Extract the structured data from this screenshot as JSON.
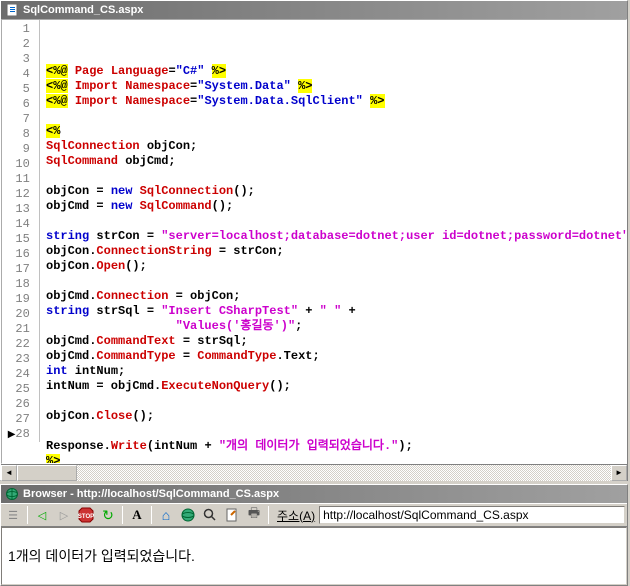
{
  "editor": {
    "title": "SqlCommand_CS.aspx",
    "lines": [
      {
        "n": "1",
        "html": "<span class='bg-yellow'>&lt;%@</span> <span class='kw-red'>Page</span> <span class='kw-red'>Language</span>=<span class='kw-blue'>\"C#\"</span> <span class='bg-yellow'>%&gt;</span>"
      },
      {
        "n": "2",
        "html": "<span class='bg-yellow'>&lt;%@</span> <span class='kw-red'>Import</span> <span class='kw-red'>Namespace</span>=<span class='kw-blue'>\"System.Data\"</span> <span class='bg-yellow'>%&gt;</span>"
      },
      {
        "n": "3",
        "html": "<span class='bg-yellow'>&lt;%@</span> <span class='kw-red'>Import</span> <span class='kw-red'>Namespace</span>=<span class='kw-blue'>\"System.Data.SqlClient\"</span> <span class='bg-yellow'>%&gt;</span>"
      },
      {
        "n": "4",
        "html": ""
      },
      {
        "n": "5",
        "html": "<span class='bg-yellow'>&lt;%</span>"
      },
      {
        "n": "6",
        "html": "<span class='kw-red'>SqlConnection</span> objCon;"
      },
      {
        "n": "7",
        "html": "<span class='kw-red'>SqlCommand</span> objCmd;"
      },
      {
        "n": "8",
        "html": ""
      },
      {
        "n": "9",
        "html": "objCon = <span class='kw-blue'>new</span> <span class='kw-red'>SqlConnection</span>();"
      },
      {
        "n": "10",
        "html": "objCmd = <span class='kw-blue'>new</span> <span class='kw-red'>SqlCommand</span>();"
      },
      {
        "n": "11",
        "html": ""
      },
      {
        "n": "12",
        "html": "<span class='kw-blue'>string</span> strCon = <span class='str'>\"server=localhost;database=dotnet;user id=dotnet;password=dotnet\"</span>;"
      },
      {
        "n": "13",
        "html": "objCon.<span class='kw-red'>ConnectionString</span> = strCon;"
      },
      {
        "n": "14",
        "html": "objCon.<span class='kw-red'>Open</span>();"
      },
      {
        "n": "15",
        "html": ""
      },
      {
        "n": "16",
        "html": "objCmd.<span class='kw-red'>Connection</span> = objCon;"
      },
      {
        "n": "17",
        "html": "<span class='kw-blue'>string</span> strSql = <span class='str'>\"Insert CSharpTest\"</span> + <span class='str'>\" \"</span> +"
      },
      {
        "n": "18",
        "html": "                  <span class='str'>\"Values('홍길동')\"</span>;"
      },
      {
        "n": "19",
        "html": "objCmd.<span class='kw-red'>CommandText</span> = strSql;"
      },
      {
        "n": "20",
        "html": "objCmd.<span class='kw-red'>CommandType</span> = <span class='kw-red'>CommandType</span>.Text;"
      },
      {
        "n": "21",
        "html": "<span class='kw-blue'>int</span> intNum;"
      },
      {
        "n": "22",
        "html": "intNum = objCmd.<span class='kw-red'>ExecuteNonQuery</span>();"
      },
      {
        "n": "23",
        "html": ""
      },
      {
        "n": "24",
        "html": "objCon.<span class='kw-red'>Close</span>();"
      },
      {
        "n": "25",
        "html": ""
      },
      {
        "n": "26",
        "html": "Response.<span class='kw-red'>Write</span>(intNum + <span class='str'>\"개의 데이터가 입력되었습니다.\"</span>);"
      },
      {
        "n": "27",
        "html": "<span class='bg-yellow'>%&gt;</span>"
      },
      {
        "n": "28",
        "html": "",
        "arrow": true
      }
    ]
  },
  "browser": {
    "title": "Browser - http://localhost/SqlCommand_CS.aspx",
    "address_label": "주소(A)",
    "address": "http://localhost/SqlCommand_CS.aspx",
    "content": "1개의 데이터가 입력되었습니다."
  },
  "icons": {
    "back": "◁",
    "forward": "▷",
    "stop": "⬢",
    "refresh": "↻",
    "font": "A",
    "home": "⌂",
    "globe": "◉",
    "search": "🔍",
    "doc": "✎",
    "print": "🖶"
  }
}
